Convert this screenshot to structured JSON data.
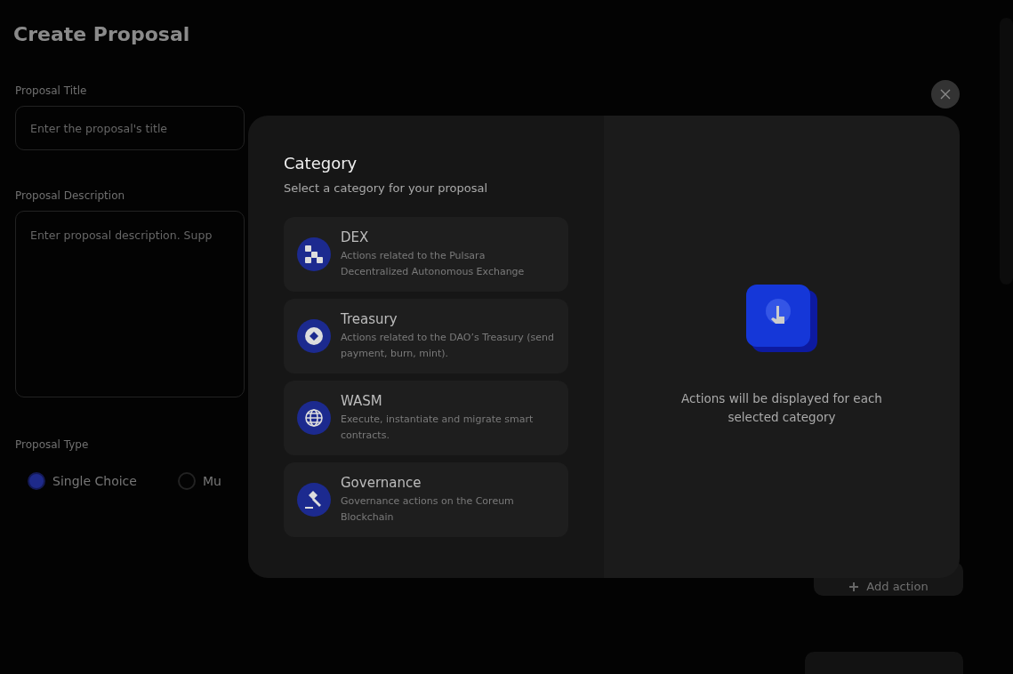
{
  "page": {
    "title": "Create Proposal",
    "title_field": {
      "label": "Proposal Title",
      "placeholder": "Enter the proposal's title"
    },
    "description_field": {
      "label": "Proposal Description",
      "placeholder": "Enter proposal description. Supp"
    },
    "proposal_type": {
      "label": "Proposal Type",
      "options": [
        {
          "label": "Single Choice",
          "selected": true
        },
        {
          "label": "Mu",
          "selected": false
        }
      ]
    },
    "add_action_button": "Add action"
  },
  "modal": {
    "title": "Category",
    "subtitle": "Select a category for your proposal",
    "categories": [
      {
        "kind": "dex",
        "name": "DEX",
        "description": "Actions related to the Pulsara Decentralized Autonomous Exchange"
      },
      {
        "kind": "treasury",
        "name": "Treasury",
        "description": "Actions related to the DAO’s Treasury (send payment, burn, mint)."
      },
      {
        "kind": "wasm",
        "name": "WASM",
        "description": "Execute, instantiate and migrate smart contracts."
      },
      {
        "kind": "governance",
        "name": "Governance",
        "description": "Governance actions on the Coreum Blockchain"
      }
    ],
    "empty_message": "Actions will be displayed for each selected category"
  }
}
